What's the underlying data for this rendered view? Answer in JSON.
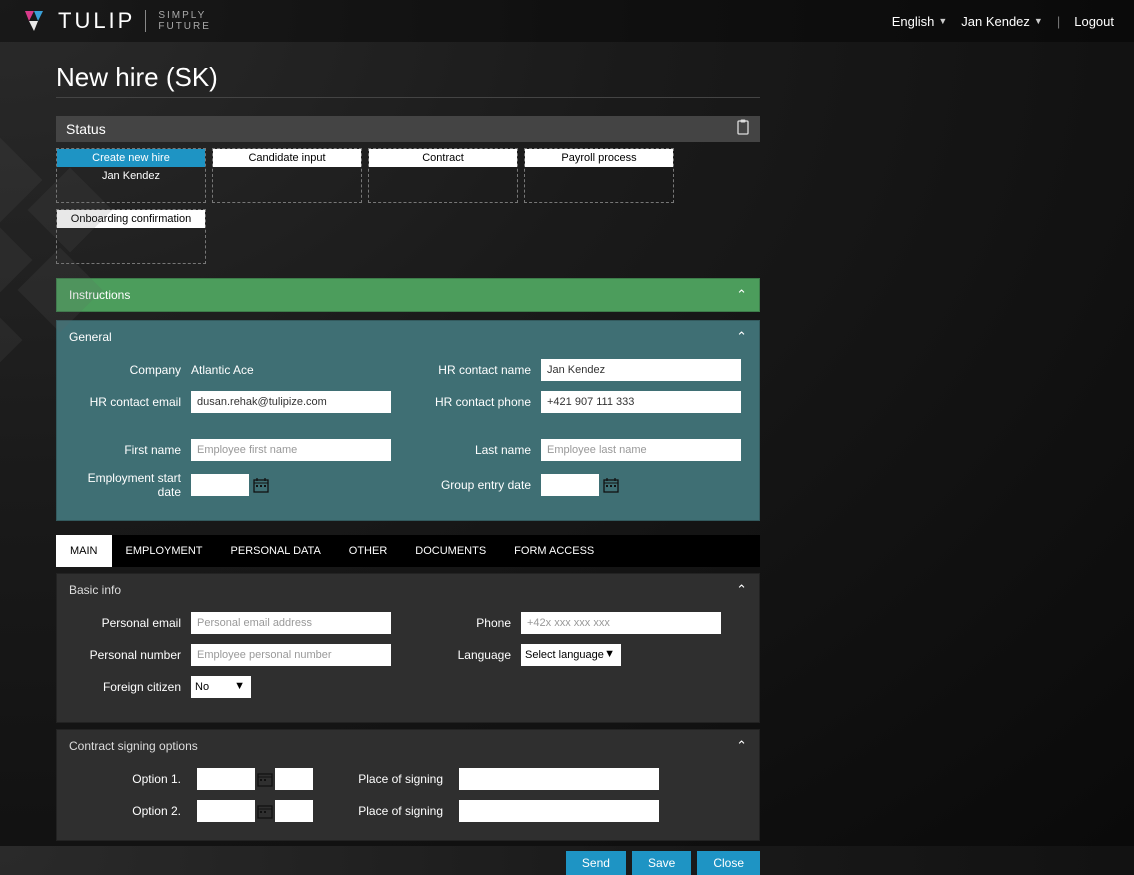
{
  "brand": {
    "name": "TULIP",
    "tag1": "SIMPLY",
    "tag2": "FUTURE"
  },
  "top": {
    "language": "English",
    "user": "Jan Kendez",
    "logout": "Logout"
  },
  "page_title": "New hire (SK)",
  "status": {
    "label": "Status"
  },
  "stages": {
    "s1": {
      "title": "Create new hire",
      "user": "Jan Kendez"
    },
    "s2": {
      "title": "Candidate input"
    },
    "s3": {
      "title": "Contract"
    },
    "s4": {
      "title": "Payroll process"
    },
    "s5": {
      "title": "Onboarding confirmation"
    }
  },
  "instructions": {
    "label": "Instructions"
  },
  "general": {
    "label": "General",
    "company_label": "Company",
    "company_value": "Atlantic Ace",
    "hr_name_label": "HR contact name",
    "hr_name_value": "Jan Kendez",
    "hr_email_label": "HR contact email",
    "hr_email_value": "dusan.rehak@tulipize.com",
    "hr_phone_label": "HR contact phone",
    "hr_phone_value": "+421 907 111 333",
    "first_name_label": "First name",
    "first_name_ph": "Employee first name",
    "last_name_label": "Last name",
    "last_name_ph": "Employee last name",
    "emp_start_label": "Employment start date",
    "group_entry_label": "Group entry date"
  },
  "tabs": {
    "main": "MAIN",
    "employment": "EMPLOYMENT",
    "personal": "PERSONAL DATA",
    "other": "OTHER",
    "documents": "DOCUMENTS",
    "access": "FORM ACCESS"
  },
  "basic": {
    "label": "Basic info",
    "pemail_label": "Personal email",
    "pemail_ph": "Personal email address",
    "phone_label": "Phone",
    "phone_ph": "+42x xxx xxx xxx",
    "pnum_label": "Personal number",
    "pnum_ph": "Employee personal number",
    "lang_label": "Language",
    "lang_ph": "Select language",
    "foreign_label": "Foreign citizen",
    "foreign_value": "No"
  },
  "signing": {
    "label": "Contract signing options",
    "opt1": "Option 1.",
    "opt2": "Option 2.",
    "place": "Place of signing"
  },
  "buttons": {
    "send": "Send",
    "save": "Save",
    "close": "Close"
  }
}
